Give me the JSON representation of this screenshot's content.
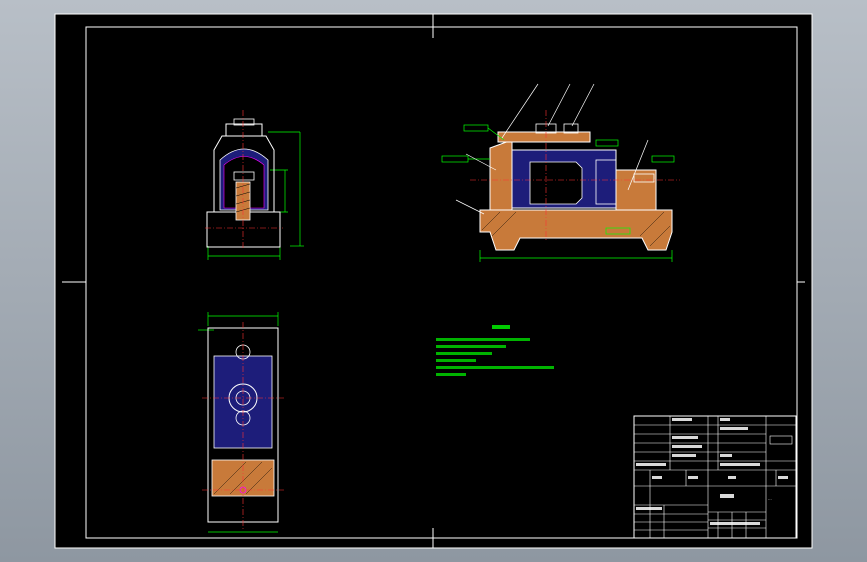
{
  "colors": {
    "background": "#000000",
    "frame": "#ffffff",
    "part_outline": "#ffffff",
    "hatch": "#c87a3a",
    "inner_fill": "#1d1d7a",
    "dimension": "#00ff00",
    "centerline": "#ff3333",
    "hidden": "#ff00ff",
    "viewport": "#9aa3ad"
  },
  "notes": {
    "lines": [
      "...",
      "...",
      "...",
      "...",
      "...",
      "..."
    ]
  },
  "title_block": {
    "drawing_name": "..."
  }
}
